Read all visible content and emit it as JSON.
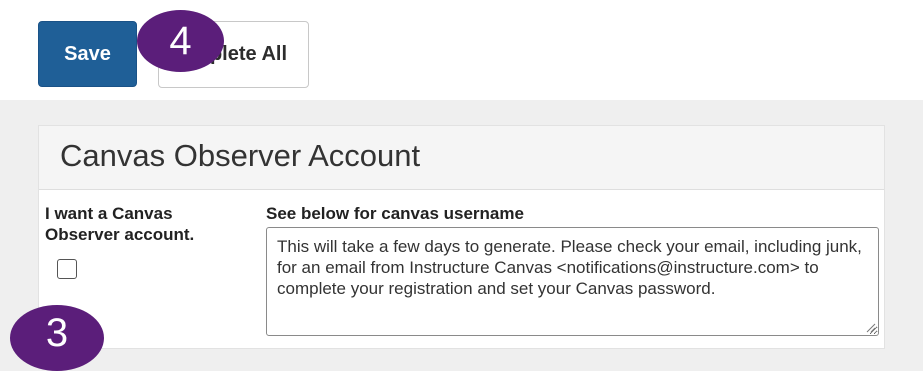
{
  "toolbar": {
    "save_label": "Save",
    "complete_all_label": "Complete All"
  },
  "annotations": {
    "step_4": "4",
    "step_3": "3",
    "badge_color": "#5b1e7a"
  },
  "panel": {
    "title": "Canvas Observer Account",
    "observer_label": "I want a Canvas Observer account.",
    "observer_checked": false,
    "username_label": "See below for canvas username",
    "username_text": "This will take a few days to generate. Please check your email, including junk, for an email from Instructure Canvas <notifications@instructure.com> to complete your registration and set your Canvas password."
  },
  "colors": {
    "primary_button": "#1f5f97",
    "page_background": "#efefef"
  }
}
